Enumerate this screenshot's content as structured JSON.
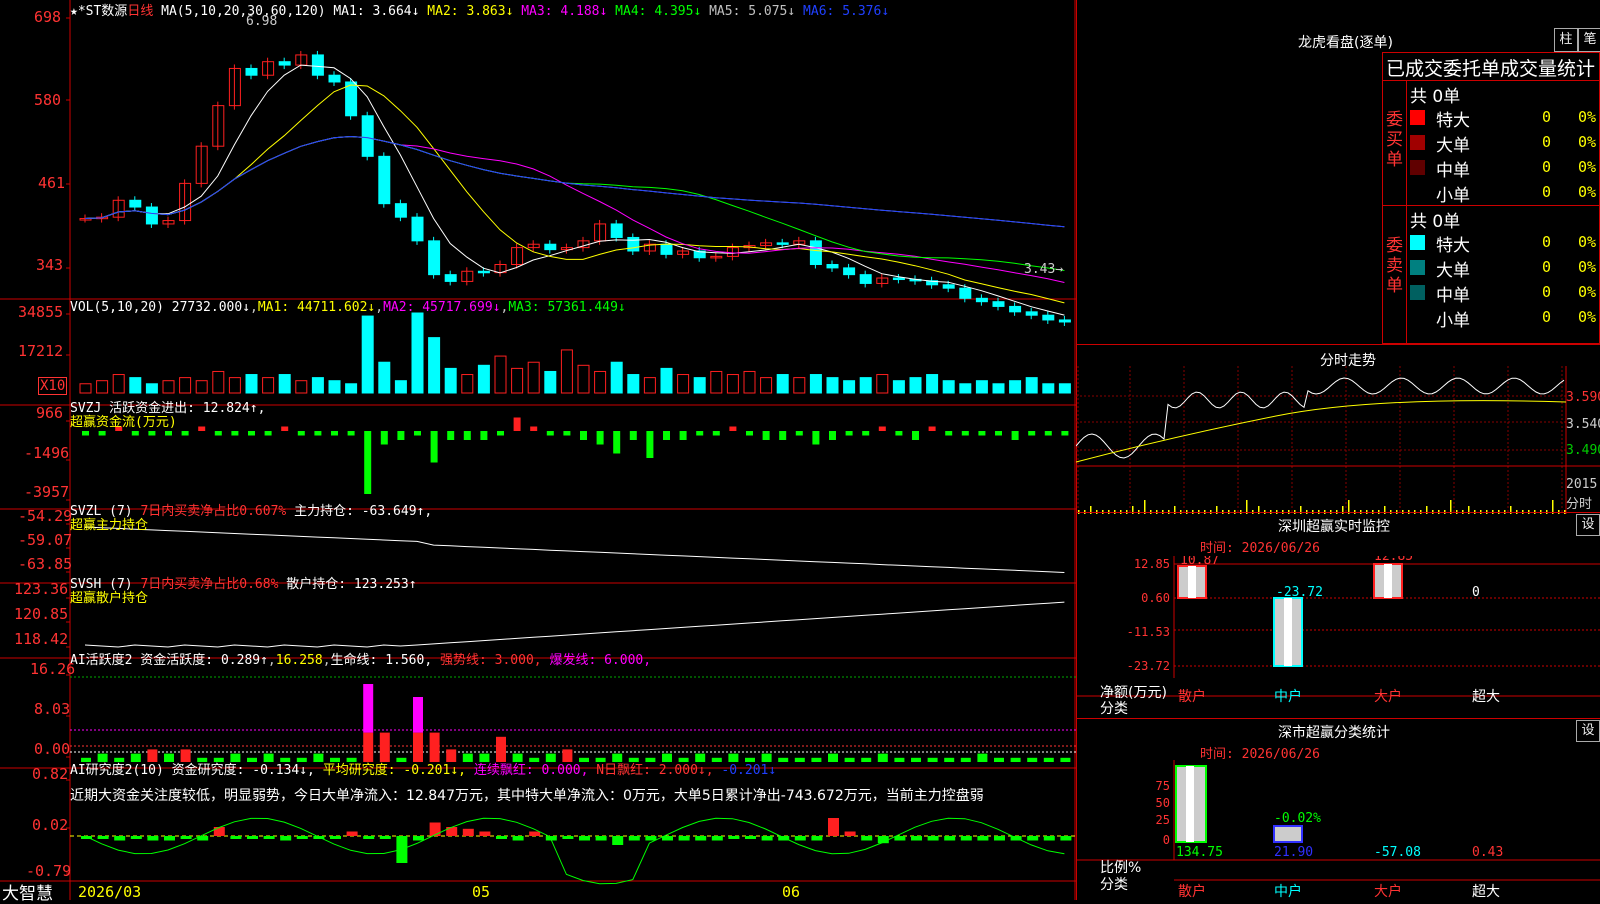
{
  "chart": {
    "stock": "★*ST数源",
    "period": "日线",
    "ma_legend": {
      "label": "MA(5,10,20,30,60,120)",
      "items": [
        {
          "name": "MA1",
          "value": "3.664↓",
          "color": "#ffffff"
        },
        {
          "name": "MA2",
          "value": "3.863↓",
          "color": "#ffff00"
        },
        {
          "name": "MA3",
          "value": "4.188↓",
          "color": "#ff00ff"
        },
        {
          "name": "MA4",
          "value": "4.395↓",
          "color": "#00ff00"
        },
        {
          "name": "MA5",
          "value": "5.075↓",
          "color": "#c0c0c0"
        },
        {
          "name": "MA6",
          "value": "5.376↓",
          "color": "#0000ff"
        }
      ]
    },
    "price_axis": [
      "698",
      "580",
      "461",
      "343"
    ],
    "high_label": "6.98",
    "low_label": "3.43",
    "vol": {
      "label": "VOL(5,10,20)",
      "value": "27732.000↓",
      "ma1": "MA1: 44711.602↓",
      "ma2": "MA2: 45717.699↓",
      "ma3": "MA3: 57361.449↓",
      "axis": [
        "34855",
        "17212"
      ],
      "unit": "X10"
    },
    "svzj": {
      "title": "SVZJ  活跃资金进出: 12.824↑,",
      "subtitle": "超赢资金流(万元)",
      "axis": [
        "966",
        "-1496",
        "-3957"
      ]
    },
    "svzl": {
      "title": "SVZL (7)",
      "pct": "7日内买卖净占比0.607%",
      "val": "主力持仓: -63.649↑,",
      "subtitle": "超赢主力持仓",
      "axis": [
        "-54.29",
        "-59.07",
        "-63.85"
      ]
    },
    "svsh": {
      "title": "SVSH (7)",
      "pct": "7日内买卖净占比0.68%",
      "val": "散户持仓: 123.253↑",
      "subtitle": "超赢散户持仓",
      "axis": [
        "123.36",
        "120.85",
        "118.42"
      ]
    },
    "ai1": {
      "title": "AI活跃度2 资金活跃度: 0.289↑",
      "v2": "16.258",
      "v3": "生命线: 1.560,",
      "v4": "强势线: 3.000,",
      "v5": "爆发线: 6.000,",
      "axis": [
        "16.26",
        "8.03",
        "0.00"
      ]
    },
    "ai2": {
      "title": "AI研究度2(10) 资金研究度: -0.134↓,",
      "avg": "平均研究度: -0.201↓,",
      "red": "连续飘红: 0.000,",
      "n": "N日飘红: 2.000↓,",
      "last": "-0.201↓",
      "summary": "近期大资金关注度较低，明显弱势，今日大单净流入：12.847万元，其中特大单净流入：0万元，大单5日累计净出-743.672万元，当前主力控盘弱",
      "axis": [
        "0.82",
        "0.02",
        "-0.79"
      ]
    },
    "dates": [
      "2026/03",
      "05",
      "06"
    ],
    "brand": "大智慧"
  },
  "right": {
    "lhb_title": "龙虎看盘(逐单)",
    "btn_zhu": "柱",
    "btn_bi": "笔",
    "stat_title": "已成交委托单成交量统计",
    "buy": {
      "side": "委买单",
      "count": "共 0单",
      "rows": [
        {
          "name": "特大",
          "v": "0",
          "p": "0%",
          "color": "#ff0000"
        },
        {
          "name": "大单",
          "v": "0",
          "p": "0%",
          "color": "#a00000"
        },
        {
          "name": "中单",
          "v": "0",
          "p": "0%",
          "color": "#600000"
        },
        {
          "name": "小单",
          "v": "0",
          "p": "0%",
          "color": "#000000"
        }
      ]
    },
    "sell": {
      "side": "委卖单",
      "count": "共 0单",
      "rows": [
        {
          "name": "特大",
          "v": "0",
          "p": "0%",
          "color": "#00ffff"
        },
        {
          "name": "大单",
          "v": "0",
          "p": "0%",
          "color": "#008080"
        },
        {
          "name": "中单",
          "v": "0",
          "p": "0%",
          "color": "#006060"
        },
        {
          "name": "小单",
          "v": "0",
          "p": "0%",
          "color": "#000000"
        }
      ]
    },
    "fs_title": "分时走势",
    "fs_axis": [
      "3.590",
      "3.540",
      "3.490"
    ],
    "fs_vol": [
      "2015",
      "分时"
    ],
    "monitor": {
      "title": "深圳超赢实时监控",
      "btn": "设",
      "time": "时间: 2026/06/26",
      "axis": [
        "12.85",
        "0.60",
        "-11.53",
        "-23.72"
      ],
      "ylabel": "净额(万元)",
      "xlabel": "分类",
      "cats": [
        "散户",
        "中户",
        "大户",
        "超大"
      ],
      "vals": [
        "10.87",
        "-23.72",
        "12.85",
        "0"
      ]
    },
    "classify": {
      "title": "深市超赢分类统计",
      "btn": "设",
      "time": "时间: 2026/06/26",
      "axis": [
        "75",
        "50",
        "25",
        "0"
      ],
      "ylabel": "比例%",
      "xlabel": "分类",
      "cats": [
        "散户",
        "中户",
        "大户",
        "超大"
      ],
      "vals": [
        "134.75",
        "21.90",
        "-57.08",
        "0.43"
      ],
      "pct_label": "-0.02%"
    }
  }
}
